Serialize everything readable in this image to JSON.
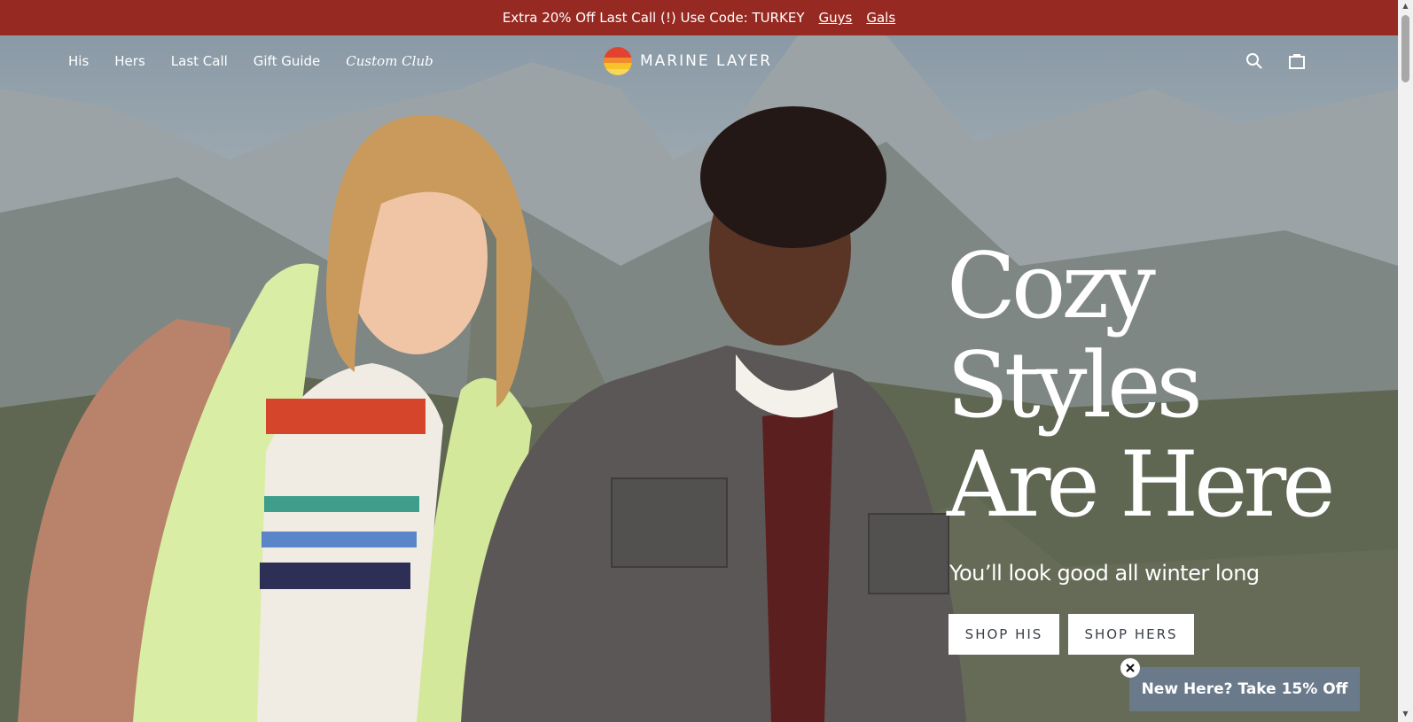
{
  "announcement": {
    "promo": "Extra 20% Off Last Call (!) Use Code: TURKEY",
    "links": [
      "Guys",
      "Gals"
    ]
  },
  "nav": {
    "items": [
      "His",
      "Hers",
      "Last Call",
      "Gift Guide",
      "Custom Club"
    ],
    "logo_text": "MARINE LAYER",
    "icons": [
      "search-icon",
      "bag-icon"
    ]
  },
  "hero": {
    "headline": [
      "Cozy",
      "Styles",
      "Are Here"
    ],
    "subhead": "You’ll look good all winter long",
    "buttons": [
      "SHOP HIS",
      "SHOP HERS"
    ]
  },
  "popup": {
    "label": "New Here? Take 15% Off"
  },
  "colors": {
    "announce_bg": "#962a22",
    "popup_bg": "#6a7a8a"
  }
}
